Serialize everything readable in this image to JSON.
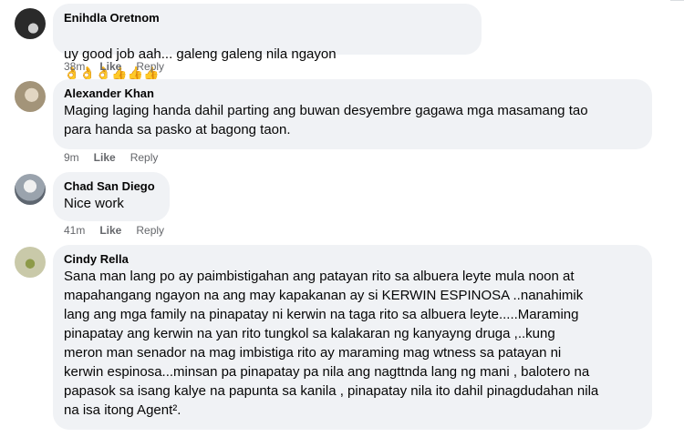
{
  "comments": [
    {
      "author": "Enihdla Oretnom",
      "text": "uy good job aah... galeng galeng nila ngayon",
      "emoji": "👌👌👌👍👍👍",
      "time": "38m",
      "like": "Like",
      "reply": "Reply"
    },
    {
      "author": "Alexander Khan",
      "text": "Maging laging handa dahil parting ang buwan desyembre gagawa mga masamang tao\npara handa sa pasko at bagong taon.",
      "time": "9m",
      "like": "Like",
      "reply": "Reply"
    },
    {
      "author": "Chad San Diego",
      "text": "Nice work",
      "time": "41m",
      "like": "Like",
      "reply": "Reply"
    },
    {
      "author": "Cindy Rella",
      "text": "Sana man lang po ay paimbistigahan ang patayan rito sa albuera leyte mula noon at\nmapahangang ngayon na ang may kapakanan ay si KERWIN ESPINOSA ..nanahimik\nlang ang mga family na pinapatay ni kerwin na taga rito sa albuera leyte.....Maraming\npinapatay ang kerwin na yan rito tungkol sa kalakaran ng kanyayng druga ,..kung\nmeron man senador na mag imbistiga rito ay maraming mag wtness sa patayan ni\nkerwin espinosa...minsan pa pinapatay pa nila ang nagttnda lang ng mani , balotero na\npapasok sa isang kalye na papunta sa kanila , pinapatay nila ito dahil pinagdudahan nila\nna isa itong Agent².",
      "time": "",
      "like": "",
      "reply": ""
    }
  ]
}
